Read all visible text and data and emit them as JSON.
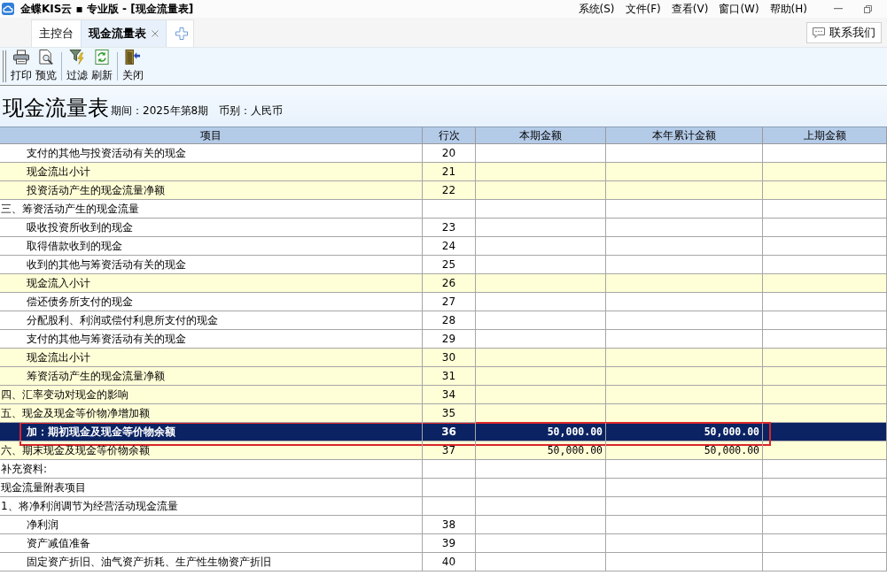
{
  "window": {
    "title": "金蝶KIS云 ▪ 专业版 - [现金流量表]"
  },
  "menu": [
    "系统(S)",
    "文件(F)",
    "查看(V)",
    "窗口(W)",
    "帮助(H)"
  ],
  "tabs": [
    {
      "label": "主控台",
      "selected": false,
      "closable": false
    },
    {
      "label": "现金流量表",
      "selected": true,
      "closable": true
    }
  ],
  "contact_button": {
    "label": "联系我们"
  },
  "toolbar": [
    [
      {
        "label": "打印",
        "kind": "print"
      },
      {
        "label": "预览",
        "kind": "preview"
      }
    ],
    [
      {
        "label": "过滤",
        "kind": "filter"
      },
      {
        "label": "刷新",
        "kind": "refresh"
      }
    ],
    [
      {
        "label": "关闭",
        "kind": "close"
      }
    ]
  ],
  "report": {
    "title": "现金流量表",
    "period": "期间：2025年第8期",
    "currency": "币别：人民币"
  },
  "table": {
    "columns": [
      "项目",
      "行次",
      "本期金额",
      "本年累计金额",
      "上期金额"
    ],
    "rows": [
      {
        "item": "支付的其他与投资活动有关的现金",
        "line": "20",
        "kind": "item",
        "total": false,
        "selected": false,
        "outlined": false
      },
      {
        "item": "现金流出小计",
        "line": "21",
        "kind": "item",
        "total": true,
        "selected": false,
        "outlined": false
      },
      {
        "item": "投资活动产生的现金流量净额",
        "line": "22",
        "kind": "item",
        "total": true,
        "selected": false,
        "outlined": false
      },
      {
        "item": "三、筹资活动产生的现金流量",
        "kind": "heading",
        "total": false,
        "selected": false,
        "outlined": false
      },
      {
        "item": "吸收投资所收到的现金",
        "line": "23",
        "kind": "item",
        "total": false,
        "selected": false,
        "outlined": false
      },
      {
        "item": "取得借款收到的现金",
        "line": "24",
        "kind": "item",
        "total": false,
        "selected": false,
        "outlined": false
      },
      {
        "item": "收到的其他与筹资活动有关的现金",
        "line": "25",
        "kind": "item",
        "total": false,
        "selected": false,
        "outlined": false
      },
      {
        "item": "现金流入小计",
        "line": "26",
        "kind": "item",
        "total": true,
        "selected": false,
        "outlined": false
      },
      {
        "item": "偿还债务所支付的现金",
        "line": "27",
        "kind": "item",
        "total": false,
        "selected": false,
        "outlined": false
      },
      {
        "item": "分配股利、利润或偿付利息所支付的现金",
        "line": "28",
        "kind": "item",
        "total": false,
        "selected": false,
        "outlined": false
      },
      {
        "item": "支付的其他与筹资活动有关的现金",
        "line": "29",
        "kind": "item",
        "total": false,
        "selected": false,
        "outlined": false
      },
      {
        "item": "现金流出小计",
        "line": "30",
        "kind": "item",
        "total": true,
        "selected": false,
        "outlined": false
      },
      {
        "item": "筹资活动产生的现金流量净额",
        "line": "31",
        "kind": "item",
        "total": true,
        "selected": false,
        "outlined": false
      },
      {
        "item": "四、汇率变动对现金的影响",
        "line": "34",
        "kind": "heading",
        "total": true,
        "selected": false,
        "outlined": false
      },
      {
        "item": "五、现金及现金等价物净增加额",
        "line": "35",
        "kind": "heading",
        "total": true,
        "selected": false,
        "outlined": false
      },
      {
        "item": "加：期初现金及现金等价物余额",
        "line": "36",
        "current": "50,000.00",
        "ytd": "50,000.00",
        "kind": "item",
        "total": false,
        "selected": true,
        "outlined": true
      },
      {
        "item": "六、期末现金及现金等价物余额",
        "line": "37",
        "current": "50,000.00",
        "ytd": "50,000.00",
        "kind": "heading",
        "total": true,
        "selected": false,
        "outlined": false
      },
      {
        "item": "补充资料:",
        "kind": "heading",
        "total": false,
        "selected": false,
        "outlined": false
      },
      {
        "item": "现金流量附表项目",
        "kind": "heading",
        "total": false,
        "selected": false,
        "outlined": false
      },
      {
        "item": "1、将净利润调节为经营活动现金流量",
        "kind": "heading",
        "total": false,
        "selected": false,
        "outlined": false
      },
      {
        "item": "净利润",
        "line": "38",
        "kind": "item",
        "total": false,
        "selected": false,
        "outlined": false
      },
      {
        "item": "资产减值准备",
        "line": "39",
        "kind": "item",
        "total": false,
        "selected": false,
        "outlined": false
      },
      {
        "item": "固定资产折旧、油气资产折耗、生产性生物资产折旧",
        "line": "40",
        "kind": "item",
        "total": false,
        "selected": false,
        "outlined": false
      }
    ]
  }
}
